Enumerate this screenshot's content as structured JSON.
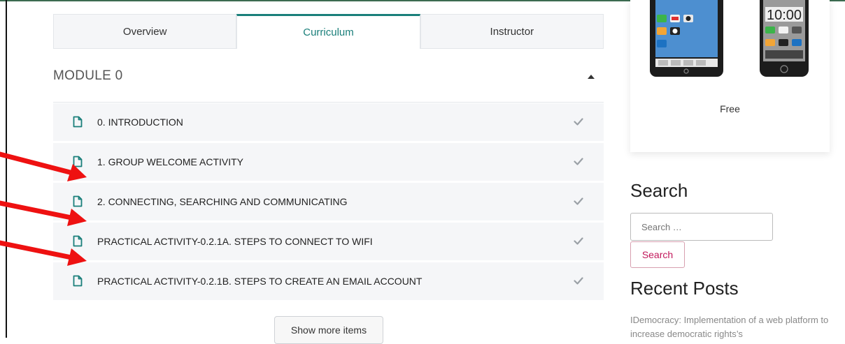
{
  "tabs": {
    "overview": "Overview",
    "curriculum": "Curriculum",
    "instructor": "Instructor"
  },
  "module": {
    "title": "MODULE 0",
    "lessons": [
      {
        "label": "0. INTRODUCTION"
      },
      {
        "label": "1. GROUP WELCOME ACTIVITY"
      },
      {
        "label": "2. CONNECTING, SEARCHING AND COMMUNICATING"
      },
      {
        "label": "PRACTICAL ACTIVITY-0.2.1A. STEPS TO CONNECT TO WIFI"
      },
      {
        "label": "PRACTICAL ACTIVITY-0.2.1B. STEPS TO CREATE AN EMAIL ACCOUNT"
      }
    ],
    "show_more": "Show more items"
  },
  "sidebar": {
    "phone_clock": "10:00",
    "price": "Free",
    "search_heading": "Search",
    "search_placeholder": "Search …",
    "search_button": "Search",
    "recent_heading": "Recent Posts",
    "recent_post": "IDemocracy: Implementation of a web platform to increase democratic rights’s"
  },
  "colors": {
    "accent": "#1a7f7a",
    "arrow": "#ee1111",
    "search_button": "#c2185b"
  },
  "icons": {
    "lesson": "document-icon",
    "complete": "checkmark-icon",
    "collapse": "caret-up-icon"
  }
}
